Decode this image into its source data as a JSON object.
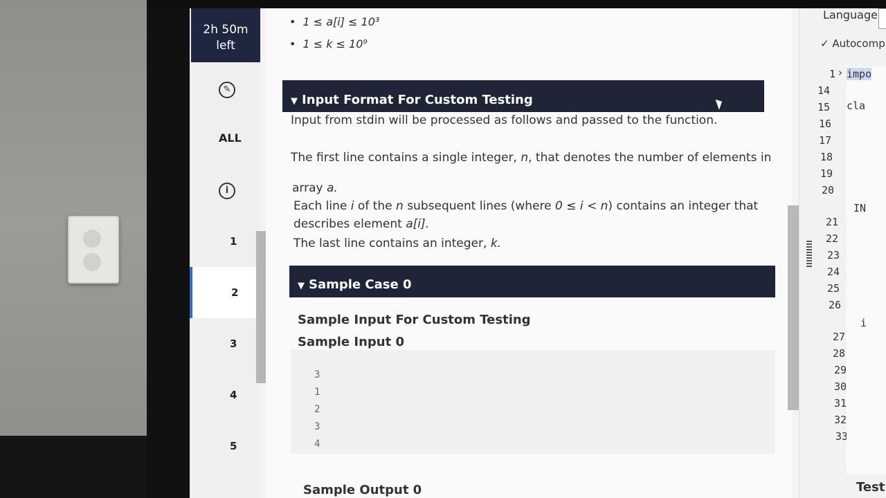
{
  "timer": {
    "line1": "2h 50m",
    "line2": "left"
  },
  "nav": {
    "all_label": "ALL",
    "info_icon": "i",
    "questions": [
      "1",
      "2",
      "3",
      "4",
      "5"
    ],
    "active_question": "2"
  },
  "constraints": [
    "1 ≤ a[i] ≤ 10³",
    "1 ≤ k ≤ 10⁹"
  ],
  "input_format": {
    "heading": "Input Format For Custom Testing",
    "intro": "Input from stdin will be processed as follows and passed to the function.",
    "line1_a": "The first line contains a single integer, ",
    "line1_var": "n",
    "line1_b": ", that denotes the number of elements in",
    "line1_c": "array ",
    "line1_arr": "a.",
    "line2_a": "Each line ",
    "line2_i": "i",
    "line2_b": " of the ",
    "line2_n": "n",
    "line2_c": " subsequent lines (where ",
    "line2_cond": "0 ≤ i < n",
    "line2_d": ") contains an integer that",
    "line3_a": "describes element ",
    "line3_el": "a[i].",
    "line4_a": "The last line contains an integer, ",
    "line4_k": "k."
  },
  "sample_case": {
    "heading": "Sample Case 0",
    "custom_label": "Sample Input For Custom Testing",
    "input_label": "Sample Input 0",
    "input_lines": [
      "3",
      "1",
      "2",
      "3",
      "4"
    ],
    "output_label": "Sample Output 0"
  },
  "editor": {
    "language_label": "Language",
    "autocomplete_label": "Autocompl",
    "line_numbers": [
      "1",
      "14",
      "15",
      "16",
      "17",
      "18",
      "19",
      "20",
      "21",
      "22",
      "23",
      "24",
      "25",
      "26",
      "27",
      "28",
      "29",
      "30",
      "31",
      "32",
      "33"
    ],
    "code_fragments": {
      "line1": "impo",
      "line15": "cla",
      "in": "IN",
      "i": "i"
    },
    "test_label": "Test"
  }
}
